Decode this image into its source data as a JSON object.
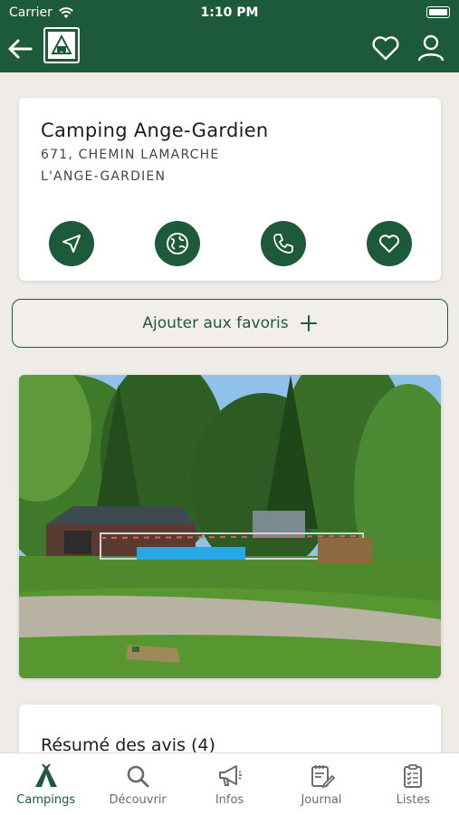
{
  "status": {
    "carrier": "Carrier",
    "time": "1:10 PM"
  },
  "nav": {
    "back_icon": "back-arrow-icon",
    "logo": "camping-logo",
    "favorite_icon": "heart-icon",
    "profile_icon": "person-icon"
  },
  "camping": {
    "name": "Camping Ange-Gardien",
    "address_line1": "671, CHEMIN LAMARCHE",
    "address_line2": "L'ANGE-GARDIEN"
  },
  "actions": [
    {
      "icon": "navigation-arrow-icon",
      "name": "directions"
    },
    {
      "icon": "globe-icon",
      "name": "website"
    },
    {
      "icon": "phone-icon",
      "name": "call"
    },
    {
      "icon": "heart-icon",
      "name": "favorite"
    }
  ],
  "favorites_button": {
    "label": "Ajouter aux favoris",
    "icon": "plus-icon"
  },
  "reviews": {
    "title": "Résumé des avis (4)"
  },
  "tabs": [
    {
      "label": "Campings",
      "icon": "tent-icon",
      "active": true
    },
    {
      "label": "Découvrir",
      "icon": "search-icon",
      "active": false
    },
    {
      "label": "Infos",
      "icon": "megaphone-icon",
      "active": false
    },
    {
      "label": "Journal",
      "icon": "journal-icon",
      "active": false
    },
    {
      "label": "Listes",
      "icon": "checklist-icon",
      "active": false
    }
  ],
  "colors": {
    "brand": "#1d5a3a",
    "background": "#efece7"
  }
}
